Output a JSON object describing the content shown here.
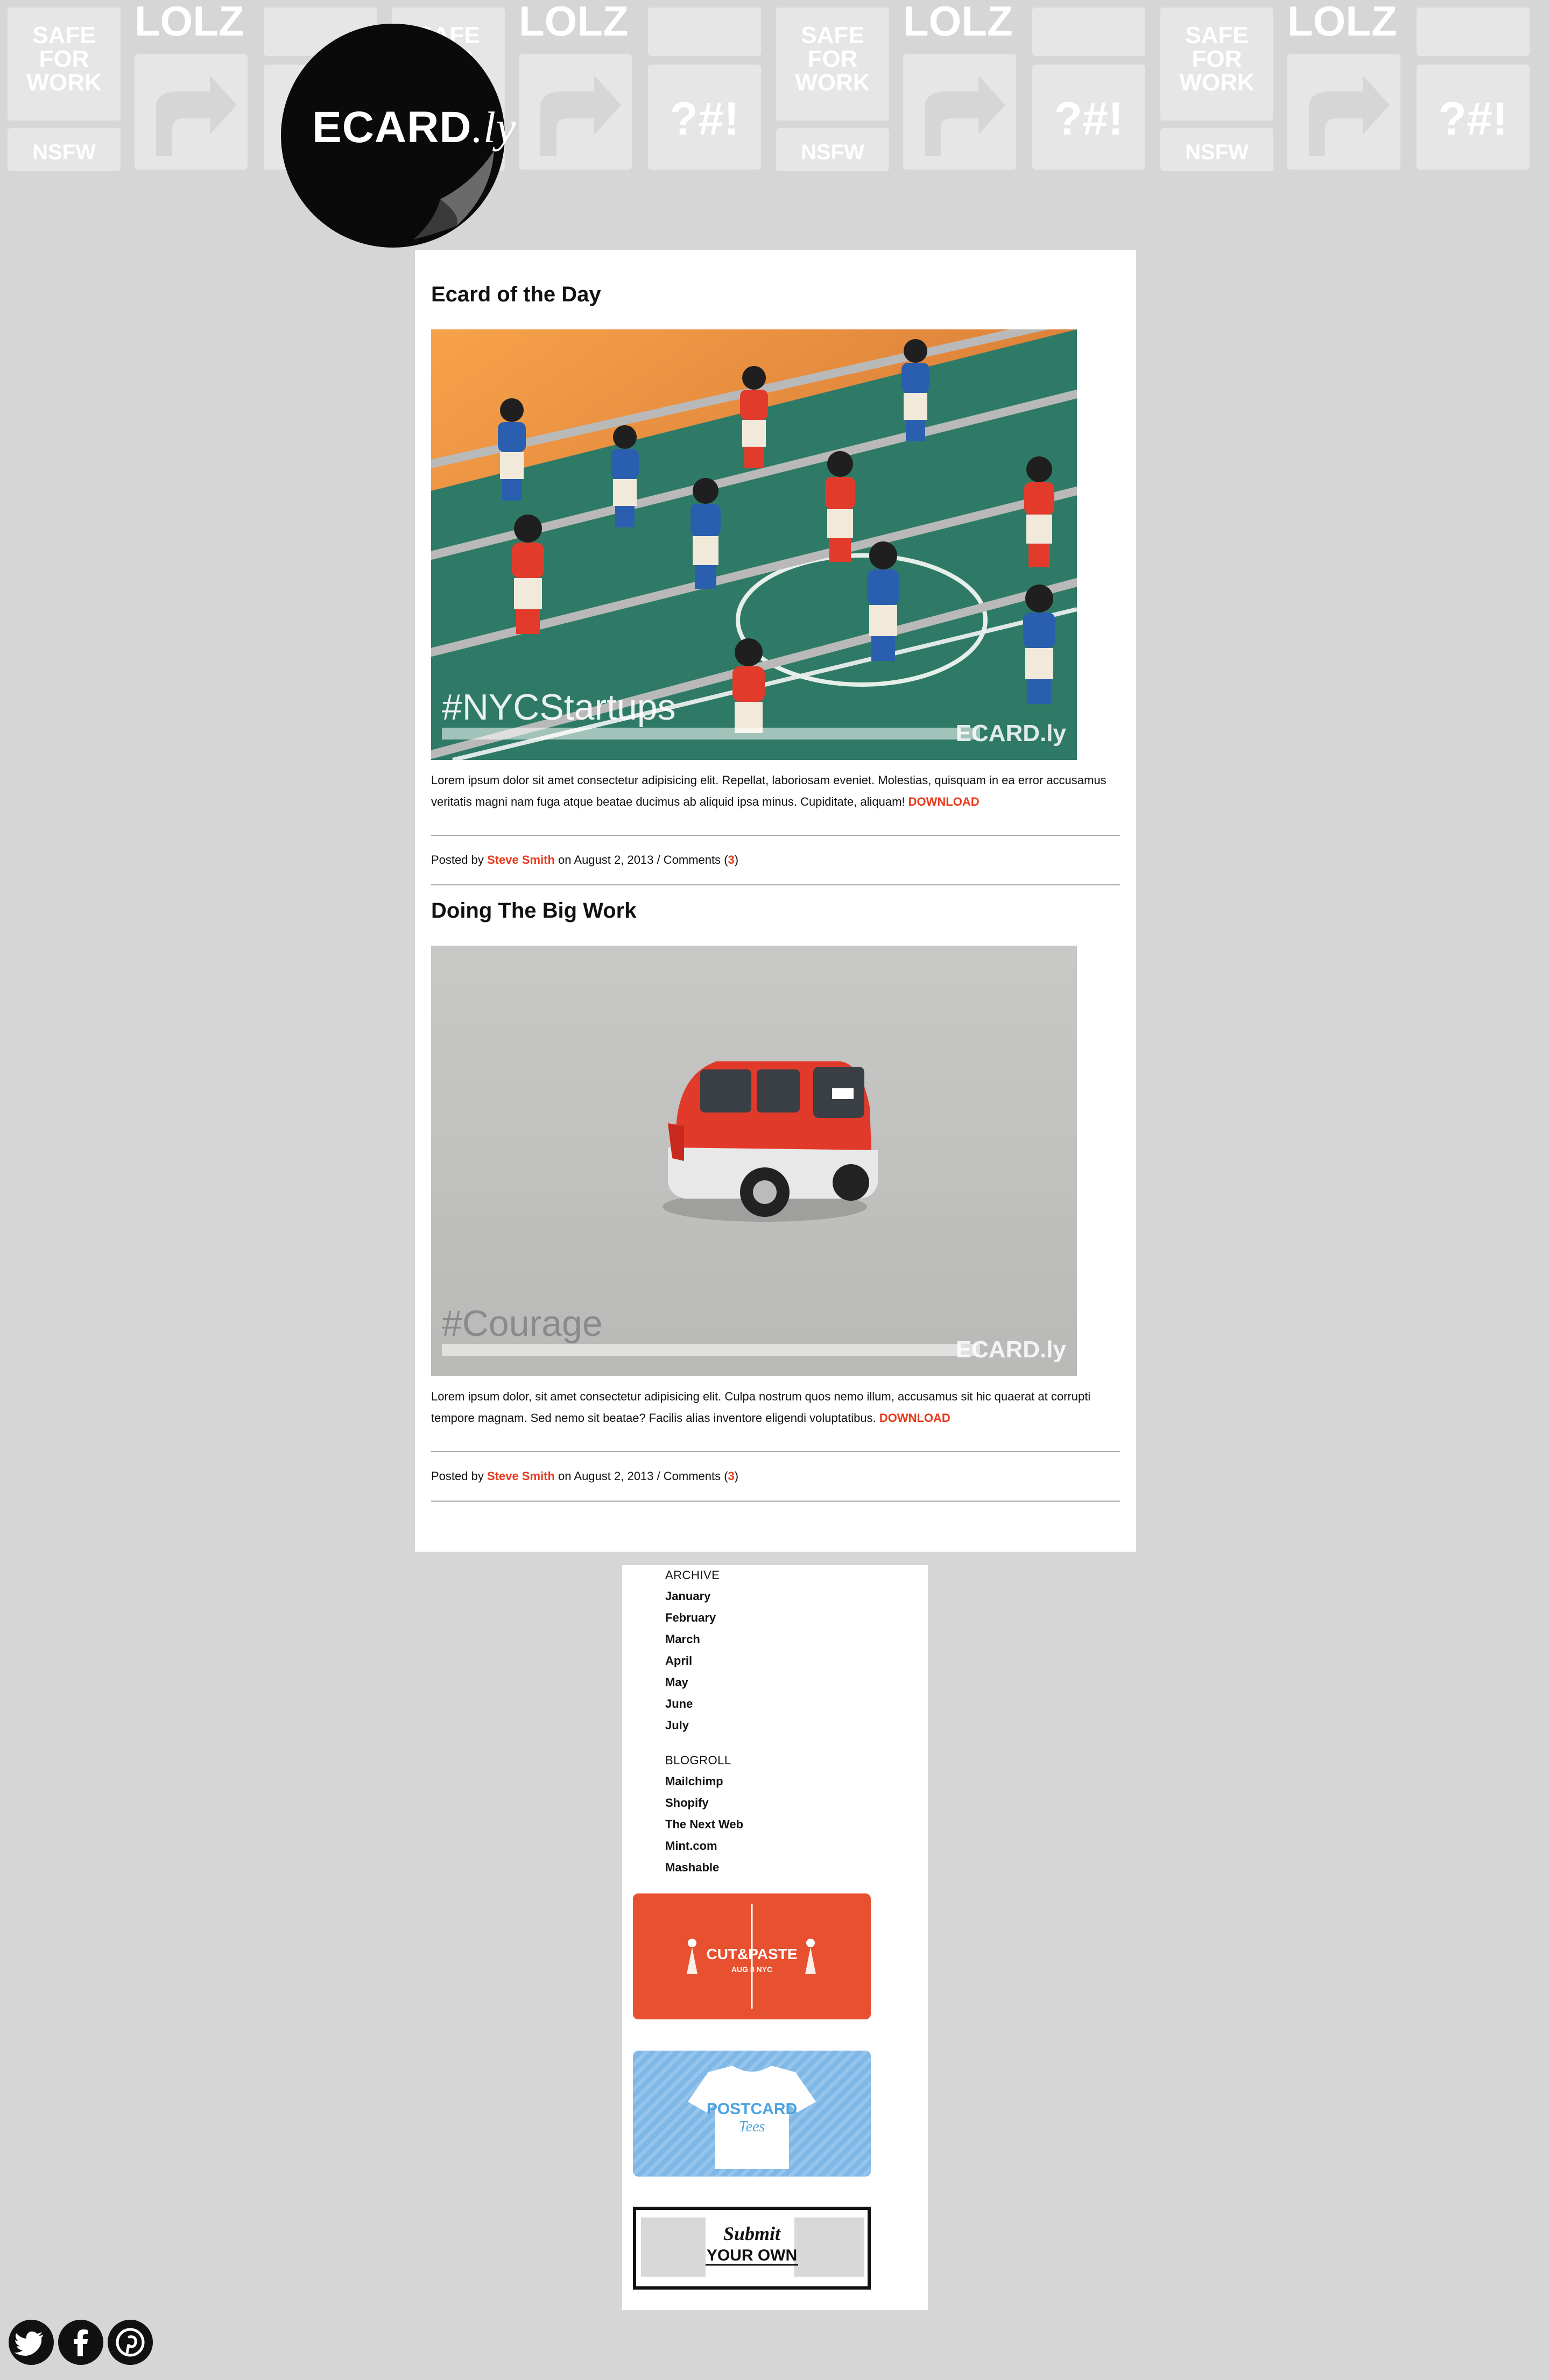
{
  "header": {
    "pattern_labels": [
      "SAFE",
      "FOR",
      "WORK",
      "NSFW",
      "LOLZ",
      "?#!"
    ]
  },
  "logo": {
    "main": "ECARD",
    "suffix": ".ly"
  },
  "posts": [
    {
      "title": "Ecard of the Day",
      "image_caption": "#NYCStartups",
      "image_brand": "ECARD.ly",
      "body": "Lorem ipsum dolor sit amet consectetur adipisicing elit. Repellat, laboriosam eveniet. Molestias, quisquam in ea error accusamus veritatis magni nam fuga atque beatae ducimus ab aliquid ipsa minus. Cupiditate, aliquam!",
      "download_label": "DOWNLOAD",
      "meta_prefix": "Posted by",
      "author": "Steve Smith",
      "meta_middle": "on August 2, 2013 / Comments (",
      "comments": "3",
      "meta_suffix": ")"
    },
    {
      "title": "Doing The Big Work",
      "image_caption": "#Courage",
      "image_brand": "ECARD.ly",
      "body": "Lorem ipsum dolor, sit amet consectetur adipisicing elit. Culpa nostrum quos nemo illum, accusamus sit hic quaerat at corrupti tempore magnam. Sed nemo sit beatae? Facilis alias inventore eligendi voluptatibus.",
      "download_label": "DOWNLOAD",
      "meta_prefix": "Posted by",
      "author": "Steve Smith",
      "meta_middle": "on August 2, 2013 / Comments (",
      "comments": "3",
      "meta_suffix": ")"
    }
  ],
  "sidebar": {
    "archive_heading": "ARCHIVE",
    "archive": [
      "January",
      "February",
      "March",
      "April",
      "May",
      "June",
      "July"
    ],
    "blogroll_heading": "BLOGROLL",
    "blogroll": [
      "Mailchimp",
      "Shopify",
      "The Next Web",
      "Mint.com",
      "Mashable"
    ],
    "ads": {
      "cutpaste_title": "CUT&PASTE",
      "cutpaste_sub": "AUG 8 NYC",
      "tees_line1": "POSTCARD",
      "tees_line2": "Tees",
      "submit_line1": "Submit",
      "submit_line2": "YOUR OWN"
    },
    "colors": {
      "cutpaste": "#e8512f",
      "tees": "#7fb7e6"
    }
  },
  "social": [
    "twitter-icon",
    "facebook-icon",
    "pinterest-icon"
  ],
  "colors": {
    "accent": "#e8391b",
    "background": "#d6d6d6",
    "panel": "#ffffff"
  }
}
